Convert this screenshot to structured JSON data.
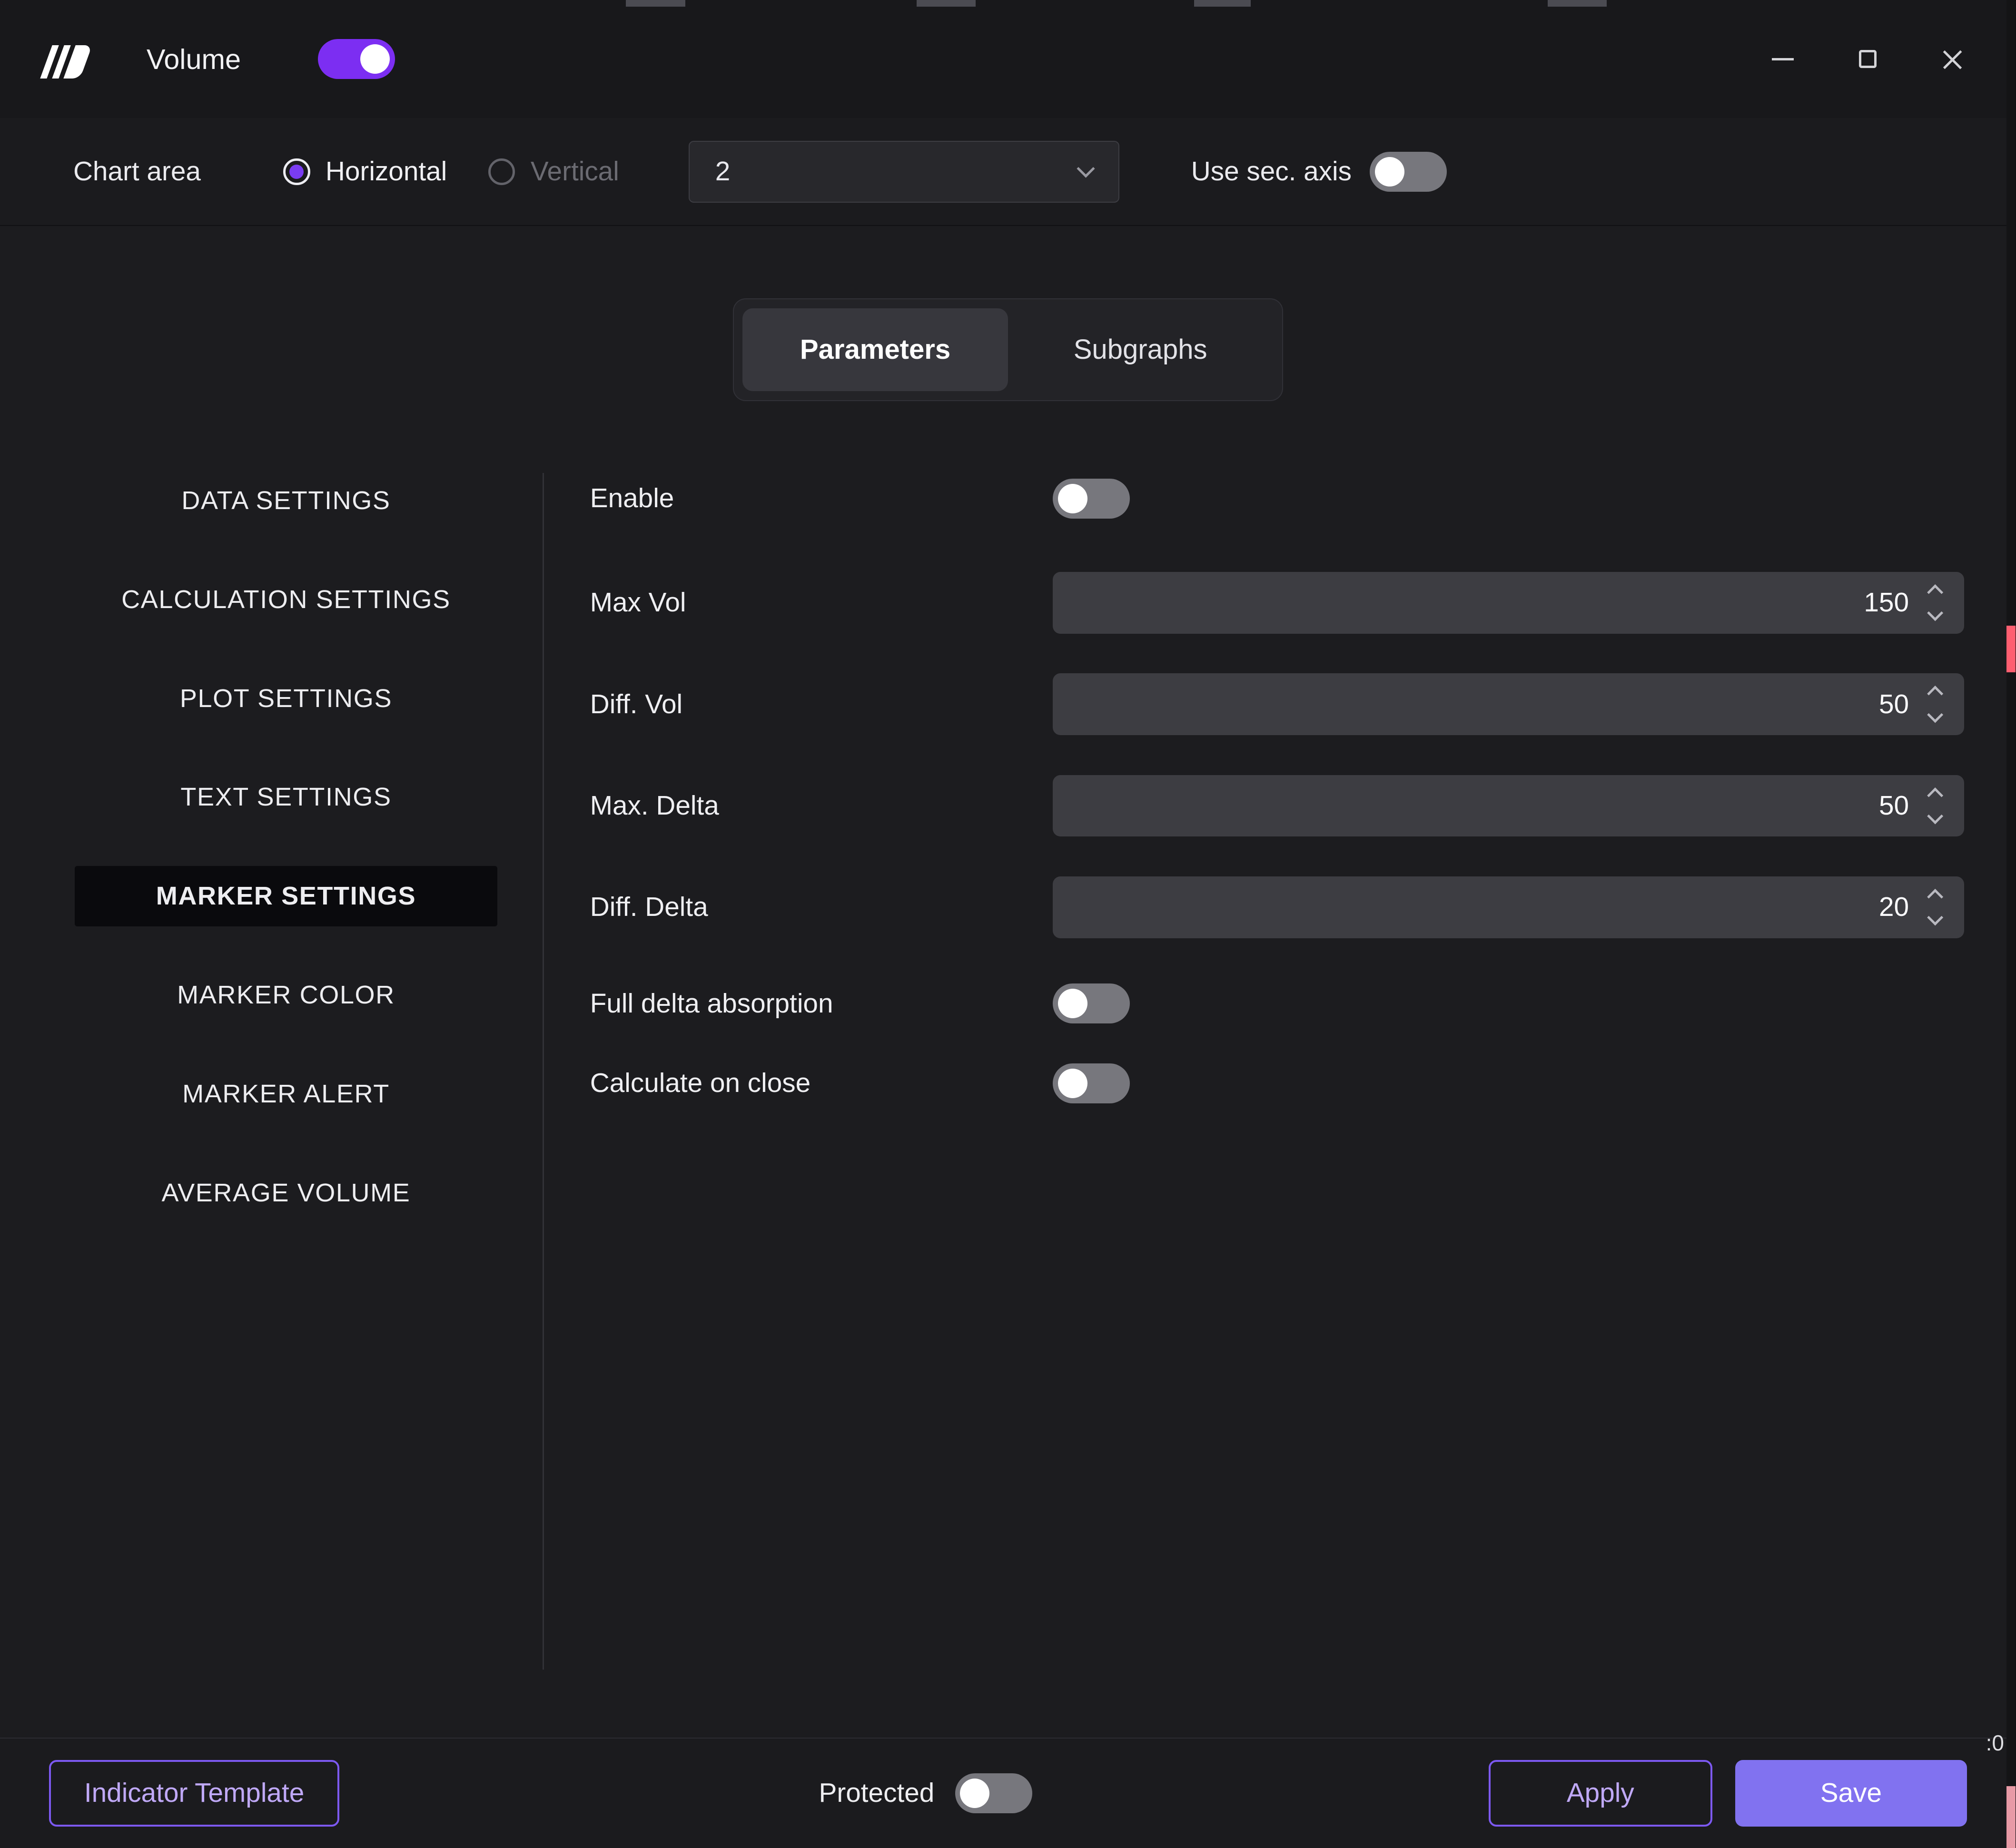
{
  "titlebar": {
    "app_title": "Volume",
    "volume_toggle": "on"
  },
  "chart_area": {
    "label": "Chart area",
    "orientation_options": [
      {
        "label": "Horizontal",
        "selected": true
      },
      {
        "label": "Vertical",
        "selected": false
      }
    ],
    "area_select": {
      "value": "2"
    },
    "sec_axis": {
      "label": "Use sec. axis",
      "enabled": false
    }
  },
  "tabs": [
    {
      "label": "Parameters",
      "active": true
    },
    {
      "label": "Subgraphs",
      "active": false
    }
  ],
  "sidebar": {
    "items": [
      {
        "label": "DATA SETTINGS",
        "active": false
      },
      {
        "label": "CALCULATION SETTINGS",
        "active": false
      },
      {
        "label": "PLOT SETTINGS",
        "active": false
      },
      {
        "label": "TEXT SETTINGS",
        "active": false
      },
      {
        "label": "MARKER SETTINGS",
        "active": true
      },
      {
        "label": "MARKER COLOR",
        "active": false
      },
      {
        "label": "MARKER ALERT",
        "active": false
      },
      {
        "label": "AVERAGE VOLUME",
        "active": false
      }
    ]
  },
  "form": {
    "rows": [
      {
        "label": "Enable",
        "type": "toggle",
        "value": "off"
      },
      {
        "label": "Max Vol",
        "type": "number",
        "value": "150"
      },
      {
        "label": "Diff. Vol",
        "type": "number",
        "value": "50"
      },
      {
        "label": "Max. Delta",
        "type": "number",
        "value": "50"
      },
      {
        "label": "Diff. Delta",
        "type": "number",
        "value": "20"
      },
      {
        "label": "Full delta absorption",
        "type": "toggle",
        "value": "off"
      },
      {
        "label": "Calculate on close",
        "type": "toggle",
        "value": "off"
      }
    ]
  },
  "footer": {
    "indicator_template_button": "Indicator Template",
    "protected_label": "Protected",
    "protected_toggle": "off",
    "apply_button": "Apply",
    "save_button": "Save"
  },
  "artifacts": {
    "axis_label": ":0"
  },
  "icons": {
    "logo": "app-logo",
    "dropdown": "chevron-down",
    "stepper": "up-down-chevrons",
    "window": [
      "minimize",
      "maximize",
      "close"
    ]
  },
  "colors": {
    "accent_purple": "#7c2ef2",
    "save_fill": "#8172f0",
    "button_border": "#7d59f2",
    "button_text": "#c0a9f8",
    "field_bg": "#3d3d42",
    "toggle_off_track": "#77777d",
    "selected_item_bg": "#0a0a0d",
    "window_bg": "#1c1c1f",
    "edge_sliver_red": "#ff5e70"
  }
}
